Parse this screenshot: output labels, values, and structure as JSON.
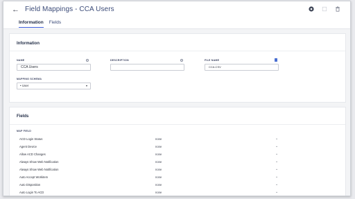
{
  "header": {
    "back_label": "←",
    "title": "Field Mappings - CCA Users",
    "tabs": [
      {
        "label": "Information",
        "active": true
      },
      {
        "label": "Fields",
        "active": false
      }
    ],
    "icons": [
      "save-icon",
      "copy-icon",
      "trash-icon"
    ]
  },
  "information": {
    "section_title": "Information",
    "name_label": "NAME",
    "name_value": "CCA Users",
    "description_label": "DESCRIPTION",
    "description_value": "",
    "file_name_label": "FILE NAME",
    "file_name_value": "CCA.CSV",
    "mapping_schema_label": "MAPPING SCHEMA",
    "mapping_schema_value": "User"
  },
  "fields": {
    "section_title": "Fields",
    "column_label": "MAP FIELD",
    "rows": [
      {
        "name": "ACD Login Status",
        "value": "none"
      },
      {
        "name": "Agent Device",
        "value": "none"
      },
      {
        "name": "Allow ACD Changes",
        "value": "none"
      },
      {
        "name": "Always Show Web Notification",
        "value": "none"
      },
      {
        "name": "Always Show Web Notification",
        "value": "none"
      },
      {
        "name": "Auto Accept Workitem",
        "value": "none"
      },
      {
        "name": "Auto Disposition",
        "value": "none"
      },
      {
        "name": "Auto Login To ACD",
        "value": "none"
      }
    ]
  },
  "colors": {
    "accent": "#3b5bdb",
    "title": "#3b4b78",
    "page_bg": "#f3f4f6"
  }
}
